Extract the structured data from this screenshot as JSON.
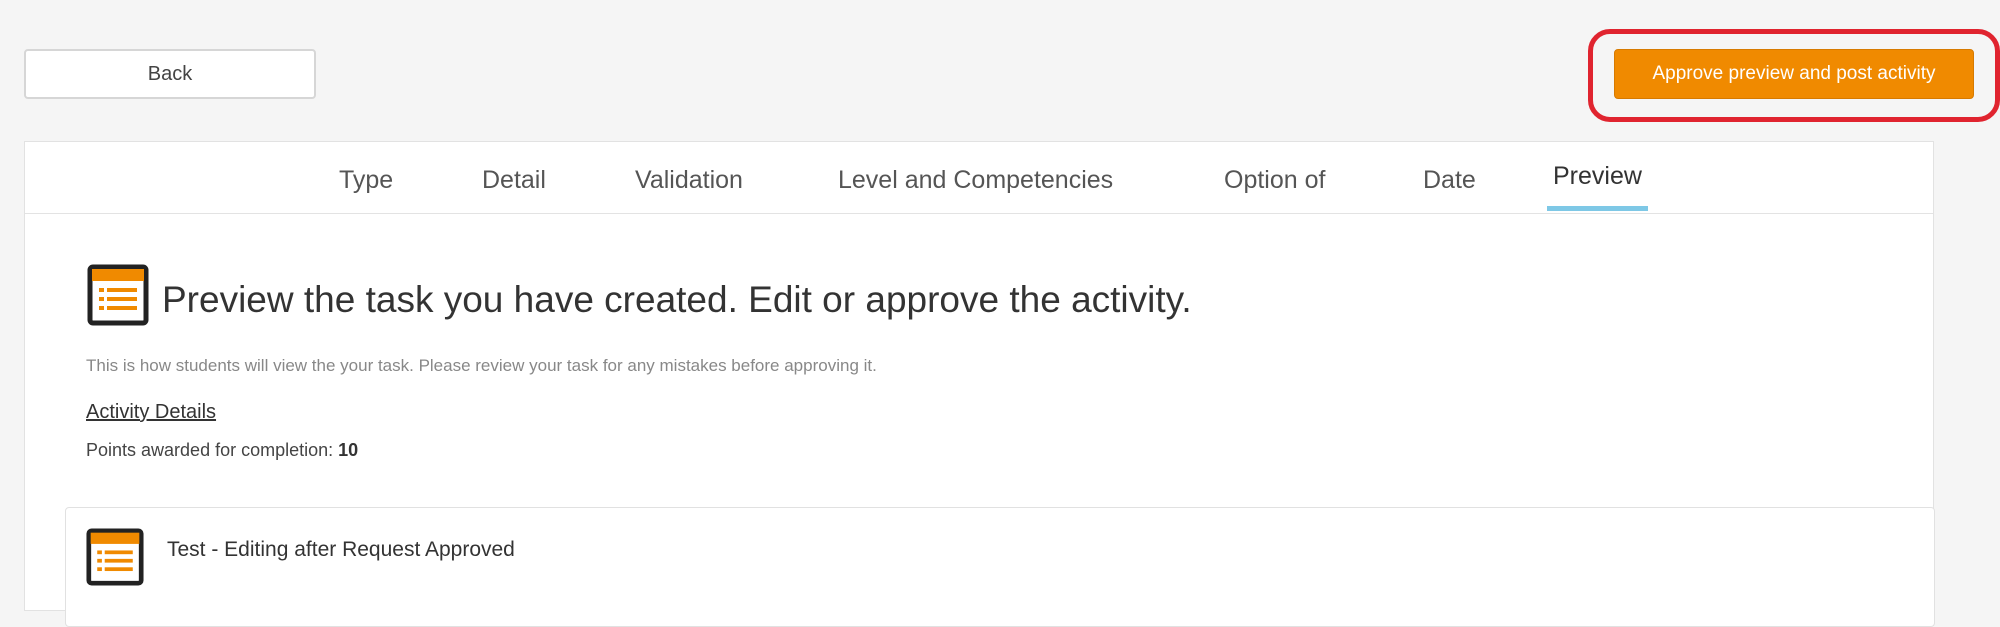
{
  "toolbar": {
    "back_label": "Back",
    "approve_label": "Approve preview and post activity"
  },
  "tabs": [
    {
      "label": "Type"
    },
    {
      "label": "Detail"
    },
    {
      "label": "Validation"
    },
    {
      "label": "Level and Competencies"
    },
    {
      "label": "Option of"
    },
    {
      "label": "Date"
    },
    {
      "label": "Preview",
      "active": true
    }
  ],
  "preview": {
    "title": "Preview the task you have created. Edit or approve the activity.",
    "subtext": "This is how students will view the your task. Please review your task for any mistakes before approving it.",
    "details_link": "Activity Details",
    "points_label": "Points awarded for completion:",
    "points_value": "10"
  },
  "task": {
    "title": "Test - Editing after Request Approved"
  },
  "colors": {
    "accent_orange": "#f08a00",
    "highlight_red": "#e0242f",
    "active_tab_underline": "#7ec8e6",
    "icon_dark": "#222222"
  },
  "icons": {
    "hero": "list-document-icon",
    "task": "list-document-icon"
  }
}
